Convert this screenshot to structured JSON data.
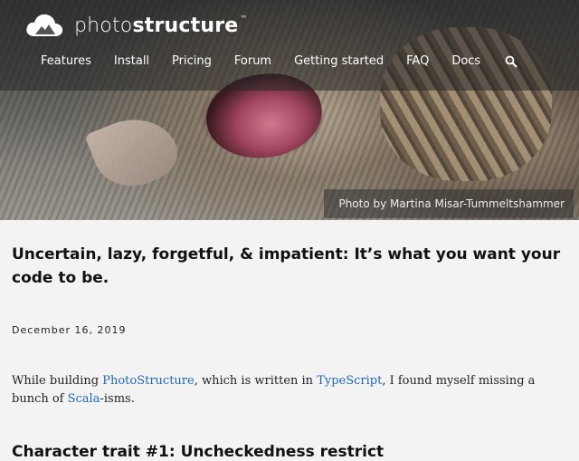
{
  "brand": {
    "logo_light": "photo",
    "logo_bold": "structure",
    "trademark": "™",
    "icon": "cloud-mountain-icon"
  },
  "nav": {
    "items": [
      "Features",
      "Install",
      "Pricing",
      "Forum",
      "Getting started",
      "FAQ",
      "Docs"
    ],
    "search_icon": "search-icon"
  },
  "hero": {
    "credit": "Photo by Martina Misar-Tummeltshammer"
  },
  "article": {
    "title": "Uncertain, lazy, forgetful, & impatient: It’s what you want your code to be.",
    "date": "December 16, 2019",
    "intro_prefix": "While building ",
    "link_photostructure": "PhotoStructure",
    "intro_mid": ", which is written in ",
    "link_typescript": "TypeScript",
    "intro_after": ", I found myself missing a bunch of ",
    "link_scala": "Scala",
    "intro_suffix": "-isms.",
    "subhead": "Character trait #1: Uncheckedness restrict"
  },
  "colors": {
    "link": "#2266bb",
    "background": "#f3f3f3",
    "text": "#111111"
  }
}
